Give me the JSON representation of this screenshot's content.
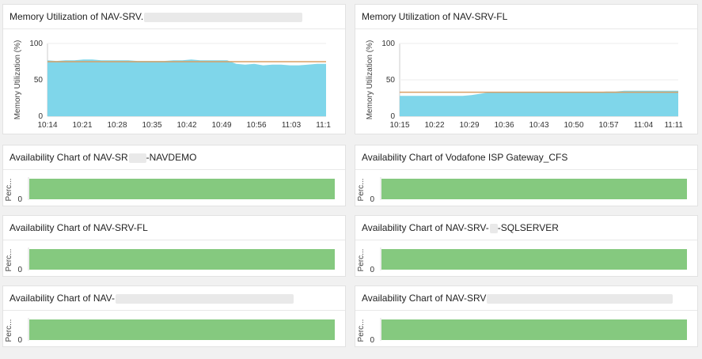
{
  "memory_panels": [
    {
      "title": "Memory Utilization of NAV-SRV.",
      "title_redacted": true,
      "chart_data": {
        "type": "area",
        "ylabel": "Memory Utilization (%)",
        "ylim": [
          0,
          100
        ],
        "yticks": [
          "100",
          "50",
          "0"
        ],
        "xticks": [
          "10:14",
          "10:21",
          "10:28",
          "10:35",
          "10:42",
          "10:49",
          "10:56",
          "11:03",
          "11:1"
        ],
        "values": [
          77,
          76,
          77,
          77,
          78,
          78,
          77,
          77,
          77,
          77,
          76,
          76,
          76,
          76,
          77,
          77,
          78,
          77,
          77,
          77,
          77,
          72,
          71,
          72,
          70,
          71,
          71,
          70,
          70,
          71,
          72,
          72
        ],
        "threshold": 75,
        "fill_color": "#7fd6ea",
        "threshold_color": "#d9a066"
      }
    },
    {
      "title": "Memory Utilization of NAV-SRV-FL",
      "title_redacted": false,
      "chart_data": {
        "type": "area",
        "ylabel": "Memory Utilization (%)",
        "ylim": [
          0,
          100
        ],
        "yticks": [
          "100",
          "50",
          "0"
        ],
        "xticks": [
          "10:15",
          "10:22",
          "10:29",
          "10:36",
          "10:43",
          "10:50",
          "10:57",
          "11:04",
          "11:11"
        ],
        "values": [
          28,
          28,
          28,
          28,
          28,
          28,
          28,
          28,
          29,
          31,
          33,
          33,
          33,
          33,
          33,
          33,
          33,
          33,
          33,
          33,
          33,
          33,
          33,
          34,
          34,
          35,
          35,
          35,
          35,
          35,
          35,
          35
        ],
        "threshold": 33,
        "fill_color": "#7fd6ea",
        "threshold_color": "#d9a066"
      }
    }
  ],
  "availability_panels": [
    {
      "title_prefix": "Availability Chart of NAV-SR",
      "title_suffix": "-NAVDEMO",
      "redacted": true
    },
    {
      "title_prefix": "Availability Chart of Vodafone ISP Gateway_CFS",
      "title_suffix": "",
      "redacted": false
    },
    {
      "title_prefix": "Availability Chart of NAV-SRV-FL",
      "title_suffix": "",
      "redacted": false
    },
    {
      "title_prefix": "Availability Chart of NAV-SRV-",
      "title_suffix": "-SQLSERVER",
      "redacted": true
    },
    {
      "title_prefix": "Availability Chart of NAV-",
      "title_suffix": "",
      "redacted": true
    },
    {
      "title_prefix": "Availability Chart of NAV-SRV",
      "title_suffix": "",
      "redacted": true
    }
  ],
  "availability_common": {
    "ylabel": "Perc...",
    "ytick": "0",
    "value_percent": 100,
    "bar_color": "#85c97f"
  }
}
